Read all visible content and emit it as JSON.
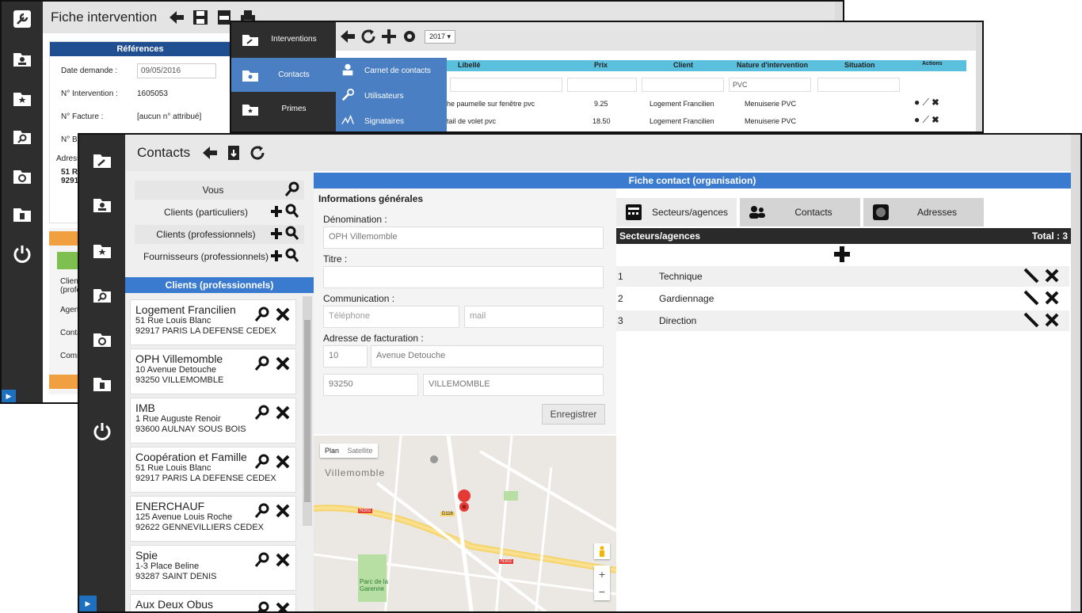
{
  "window1": {
    "title": "Fiche intervention",
    "references": {
      "header": "Références",
      "rows": [
        {
          "label": "Date demande :",
          "value": "09/05/2016"
        },
        {
          "label": "N° Intervention :",
          "value": "1605053"
        },
        {
          "label": "N° Facture :",
          "value": "[aucun n° attribué]"
        },
        {
          "label": "N° Bo",
          "value": ""
        }
      ],
      "address_label": "Adress",
      "address_lines": [
        "51 Ru",
        "9291"
      ]
    },
    "partial_labels": [
      "Clien",
      "(profe",
      "Agen",
      "Conta",
      "Comm"
    ]
  },
  "window2": {
    "nav": [
      {
        "label": "Interventions"
      },
      {
        "label": "Contacts"
      },
      {
        "label": "Primes"
      }
    ],
    "submenu": [
      {
        "label": "Carnet de contacts"
      },
      {
        "label": "Utilisateurs"
      },
      {
        "label": "Signataires"
      }
    ],
    "year": "2017",
    "columns": [
      "Libellé",
      "Prix",
      "Client",
      "Nature d'intervention",
      "Situation",
      "Actions"
    ],
    "filter_value": "PVC",
    "rows": [
      {
        "libelle": "he paumelle sur fenêtre pvc",
        "prix": "9.25",
        "client": "Logement Francilien",
        "nature": "Menuiserie PVC"
      },
      {
        "libelle": "tail de volet pvc",
        "prix": "18.50",
        "client": "Logement Francilien",
        "nature": "Menuiserie PVC"
      }
    ]
  },
  "window3": {
    "title": "Contacts",
    "categories": [
      {
        "label": "Vous"
      },
      {
        "label": "Clients (particuliers)"
      },
      {
        "label": "Clients (professionnels)"
      },
      {
        "label": "Fournisseurs (professionnels)"
      }
    ],
    "list_header": "Clients (professionnels)",
    "clients": [
      {
        "name": "Logement Francilien",
        "street": "51 Rue Louis Blanc",
        "city": "92917 PARIS LA DEFENSE CEDEX"
      },
      {
        "name": "OPH Villemomble",
        "street": "10 Avenue Detouche",
        "city": "93250 VILLEMOMBLE"
      },
      {
        "name": "IMB",
        "street": "1 Rue Auguste Renoir",
        "city": "93600 AULNAY SOUS BOIS"
      },
      {
        "name": "Coopération et Famille",
        "street": "51 Rue Louis Blanc",
        "city": "92917 PARIS LA DEFENSE CEDEX"
      },
      {
        "name": "ENERCHAUF",
        "street": "125 Avenue Louis Roche",
        "city": "92622 GENNEVILLIERS CEDEX"
      },
      {
        "name": "Spie",
        "street": "1-3 Place Beline",
        "city": "93287 SAINT DENIS"
      },
      {
        "name": "Aux Deux Obus",
        "street": "",
        "city": ""
      }
    ],
    "fiche_header": "Fiche contact (organisation)",
    "info_title": "Informations générales",
    "denomination_label": "Dénomination :",
    "denomination_value": "OPH Villemomble",
    "titre_label": "Titre :",
    "communication_label": "Communication :",
    "phone_placeholder": "Téléphone",
    "mail_placeholder": "mail",
    "adresse_label": "Adresse de facturation :",
    "street_number": "10",
    "street_name": "Avenue Detouche",
    "postal_code": "93250",
    "city": "VILLEMOMBLE",
    "save_button": "Enregistrer",
    "map": {
      "plan": "Plan",
      "satellite": "Satellite",
      "town": "Villemomble",
      "park1": "Parc de la",
      "park2": "Garenne",
      "road1": "N302",
      "road2": "D116",
      "road3": "N302"
    },
    "tabs": [
      {
        "label": "Secteurs/agences"
      },
      {
        "label": "Contacts"
      },
      {
        "label": "Adresses"
      }
    ],
    "sectors_title": "Secteurs/agences",
    "sectors_total": "Total : 3",
    "sectors": [
      {
        "num": "1",
        "name": "Technique"
      },
      {
        "num": "2",
        "name": "Gardiennage"
      },
      {
        "num": "3",
        "name": "Direction"
      }
    ]
  }
}
